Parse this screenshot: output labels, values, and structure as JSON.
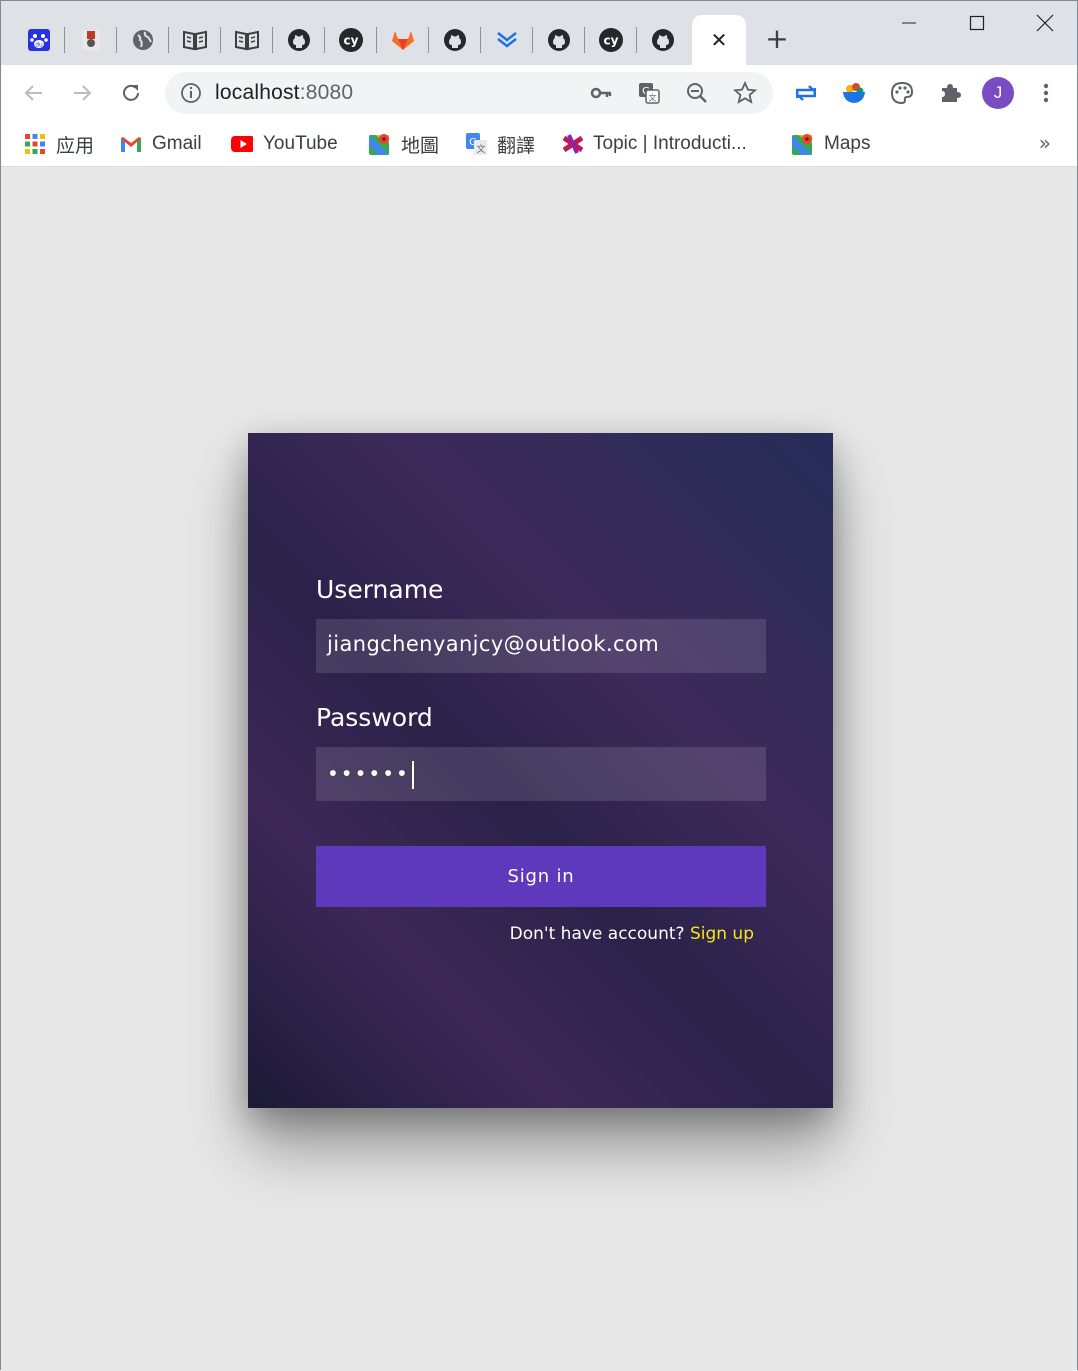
{
  "browser": {
    "tabs": [
      {
        "icon": "baidu-icon",
        "color": "#2932e1",
        "glyph": "du"
      },
      {
        "icon": "app-icon",
        "color": "#c0392b",
        "glyph": "▣"
      },
      {
        "icon": "globe-icon",
        "color": "#5f6368",
        "glyph": "◉"
      },
      {
        "icon": "book-icon",
        "color": "#3c4043",
        "glyph": "📖"
      },
      {
        "icon": "book-icon",
        "color": "#3c4043",
        "glyph": "📖"
      },
      {
        "icon": "github-icon",
        "color": "#24292e"
      },
      {
        "icon": "cypress-icon",
        "color": "#24292e",
        "glyph": "cy"
      },
      {
        "icon": "gitlab-icon",
        "color": "#e24329"
      },
      {
        "icon": "github-icon",
        "color": "#24292e"
      },
      {
        "icon": "download-icon",
        "color": "#1a73e8",
        "glyph": "⇊"
      },
      {
        "icon": "github-icon",
        "color": "#24292e"
      },
      {
        "icon": "cypress-icon",
        "color": "#24292e",
        "glyph": "cy"
      },
      {
        "icon": "github-icon",
        "color": "#24292e"
      }
    ],
    "active_tab_close": "✕",
    "new_tab": "+",
    "url_host": "localhost",
    "url_port": ":8080",
    "profile_initial": "J",
    "bookmarks": [
      {
        "label": "应用",
        "icon": "apps-grid-icon"
      },
      {
        "label": "Gmail",
        "icon": "gmail-icon"
      },
      {
        "label": "YouTube",
        "icon": "youtube-icon"
      },
      {
        "label": "地圖",
        "icon": "maps-icon"
      },
      {
        "label": "翻譯",
        "icon": "translate-icon"
      },
      {
        "label": "Topic | Introducti...",
        "icon": "topic-icon"
      },
      {
        "label": "Maps",
        "icon": "maps-icon"
      }
    ],
    "bookmarks_more": "»"
  },
  "login": {
    "username_label": "Username",
    "username_value": "jiangchenyanjcy@outlook.com",
    "password_label": "Password",
    "password_value": "••••••",
    "signin_label": "Sign in",
    "no_account_text": "Don't have account? ",
    "signup_label": "Sign up"
  },
  "colors": {
    "signin_button": "#5f39bb",
    "signup_link": "#f5e61a",
    "avatar": "#7b4bc4"
  }
}
